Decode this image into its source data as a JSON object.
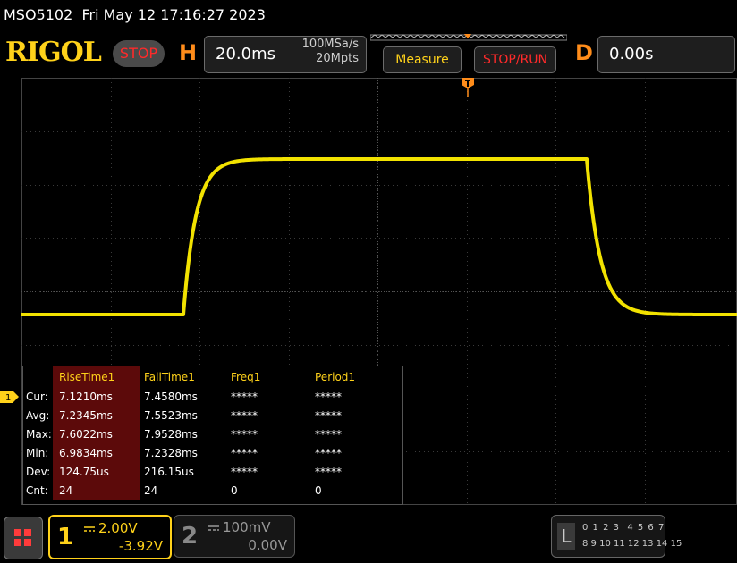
{
  "topline": {
    "model": "MSO5102",
    "datetime": "Fri May 12 17:16:27 2023"
  },
  "header": {
    "logo": "RIGOL",
    "run_state": "STOP",
    "horizontal": {
      "letter": "H",
      "timebase": "20.0ms",
      "sample_rate": "100MSa/s",
      "memory_depth": "20Mpts"
    },
    "measure_label": "Measure",
    "stop_run_label": "STOP/RUN",
    "delay": {
      "letter": "D",
      "value": "0.00s"
    }
  },
  "colors": {
    "trace": "#ffee00",
    "accent_yellow": "#ffd21a",
    "accent_orange": "#ff8c1a",
    "stop_red": "#ff2a2a",
    "grid": "#3a3a3a"
  },
  "ch1_marker_label": "1",
  "measurements": {
    "headers": [
      "RiseTime1",
      "FallTime1",
      "Freq1",
      "Period1"
    ],
    "rows": [
      {
        "label": "Cur:",
        "values": [
          "7.1210ms",
          "7.4580ms",
          "*****",
          "*****"
        ]
      },
      {
        "label": "Avg:",
        "values": [
          "7.2345ms",
          "7.5523ms",
          "*****",
          "*****"
        ]
      },
      {
        "label": "Max:",
        "values": [
          "7.6022ms",
          "7.9528ms",
          "*****",
          "*****"
        ]
      },
      {
        "label": "Min:",
        "values": [
          "6.9834ms",
          "7.2328ms",
          "*****",
          "*****"
        ]
      },
      {
        "label": "Dev:",
        "values": [
          "124.75us",
          "216.15us",
          "*****",
          "*****"
        ]
      },
      {
        "label": "Cnt:",
        "values": [
          "24",
          "24",
          "0",
          "0"
        ]
      }
    ]
  },
  "footer": {
    "ch1": {
      "number": "1",
      "scale": "2.00V",
      "offset": "-3.92V"
    },
    "ch2": {
      "number": "2",
      "scale": "100mV",
      "offset": "0.00V"
    },
    "la": {
      "letter": "L",
      "row1": "0 1 2 3  4 5 6 7",
      "row2": "8 9 10 11 12 13 14 15"
    }
  }
}
